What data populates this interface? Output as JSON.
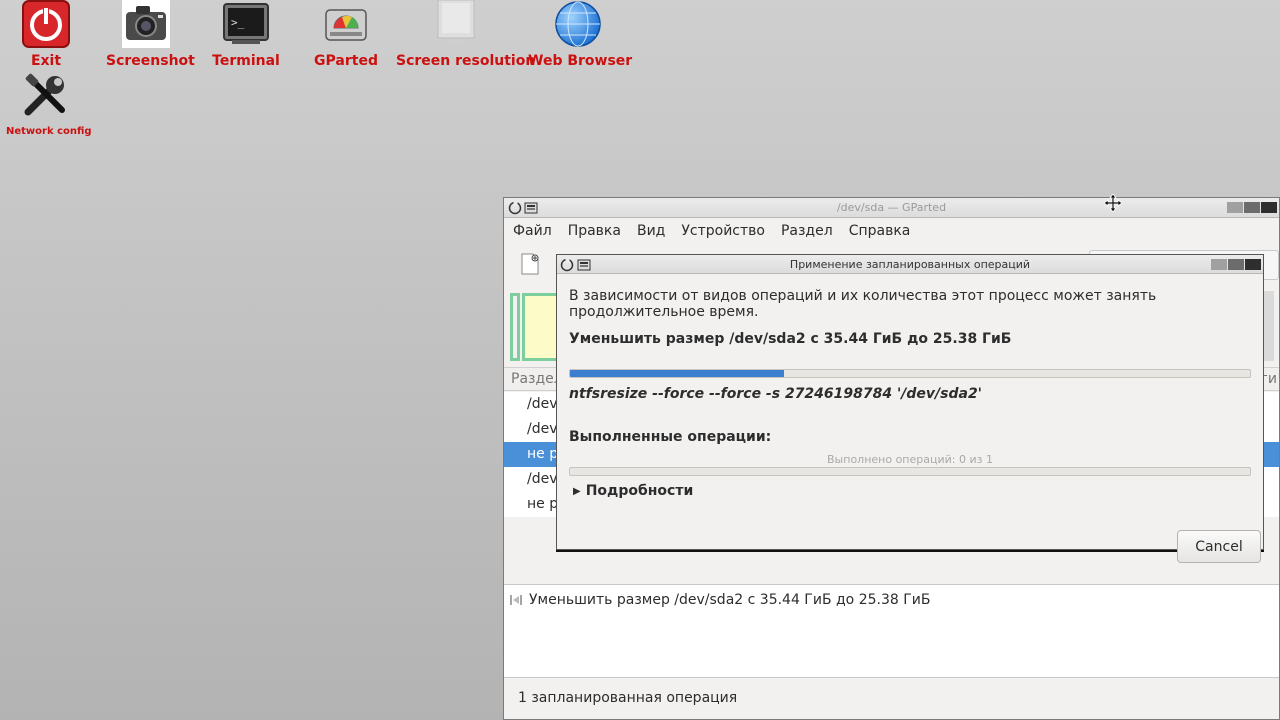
{
  "desktop": {
    "icons": [
      {
        "label": "Exit",
        "icon": "power-icon"
      },
      {
        "label": "Screenshot",
        "icon": "camera-icon"
      },
      {
        "label": "Terminal",
        "icon": "terminal-icon"
      },
      {
        "label": "GParted",
        "icon": "disk-icon"
      },
      {
        "label": "Screen resolution",
        "icon": "monitor-icon"
      },
      {
        "label": "Web Browser",
        "icon": "globe-icon"
      },
      {
        "label": "Network config",
        "icon": "tools-icon"
      }
    ],
    "label_color": "#cc1010"
  },
  "gparted": {
    "title": "/dev/sda — GParted",
    "menu": [
      "Файл",
      "Правка",
      "Вид",
      "Устройство",
      "Раздел",
      "Справка"
    ],
    "list_header": {
      "partition": "Раздел",
      "right_fragment": "ги"
    },
    "rows": [
      {
        "text": "/dev/",
        "selected": false
      },
      {
        "text": "/dev/",
        "selected": false
      },
      {
        "text": "не ра",
        "selected": true
      },
      {
        "text": "/dev/",
        "selected": false
      },
      {
        "text": "не ра",
        "selected": false
      }
    ],
    "pending_operation": "Уменьшить размер /dev/sda2 с 35.44 ГиБ до 25.38 ГиБ",
    "status": "1 запланированная операция"
  },
  "dialog": {
    "title": "Применение запланированных операций",
    "info": "В зависимости от видов операций и их количества этот процесс может занять продолжительное время.",
    "current_operation": "Уменьшить размер /dev/sda2 с 35.44 ГиБ до 25.38 ГиБ",
    "current_progress_fraction": 0.315,
    "command": "ntfsresize --force --force -s 27246198784 '/dev/sda2'",
    "completed_label": "Выполненные операции:",
    "completed_text": "Выполнено операций: 0 из 1",
    "completed_progress_fraction": 0,
    "details_label": "Подробности",
    "cancel_label": "Cancel"
  },
  "colors": {
    "accent": "#3c7fd1",
    "selection": "#4a90d9"
  }
}
